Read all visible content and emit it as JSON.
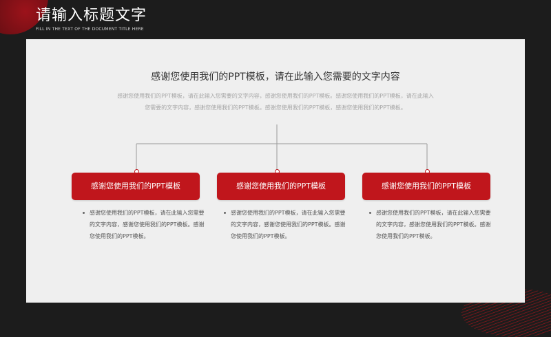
{
  "header": {
    "title": "请输入标题文字",
    "subtitle": "FILL IN THE TEXT OF THE DOCUMENT TITLE HERE"
  },
  "main": {
    "heading": "感谢您使用我们的PPT模板，请在此输入您需要的文字内容",
    "intro": "感谢您使用我们的PPT模板，请在此输入您需要的文字内容，感谢您使用我们的PPT模板。感谢您使用我们的PPT模板，请在此输入您需要的文字内容，感谢您使用我们的PPT模板。感谢您使用我们的PPT模板，感谢您使用我们的PPT模板。",
    "boxes": [
      {
        "label": "感谢您使用我们的PPT模板",
        "text": "感谢您使用我们的PPT模板，请在此输入您需要的文字内容，感谢您使用我们的PPT模板。感谢您使用我们的PPT模板。"
      },
      {
        "label": "感谢您使用我们的PPT模板",
        "text": "感谢您使用我们的PPT模板，请在此输入您需要的文字内容，感谢您使用我们的PPT模板。感谢您使用我们的PPT模板。"
      },
      {
        "label": "感谢您使用我们的PPT模板",
        "text": "感谢您使用我们的PPT模板，请在此输入您需要的文字内容，感谢您使用我们的PPT模板。感谢您使用我们的PPT模板。"
      }
    ]
  },
  "colors": {
    "accent": "#c0161c",
    "background": "#1c1c1c",
    "panel": "#efefef"
  }
}
